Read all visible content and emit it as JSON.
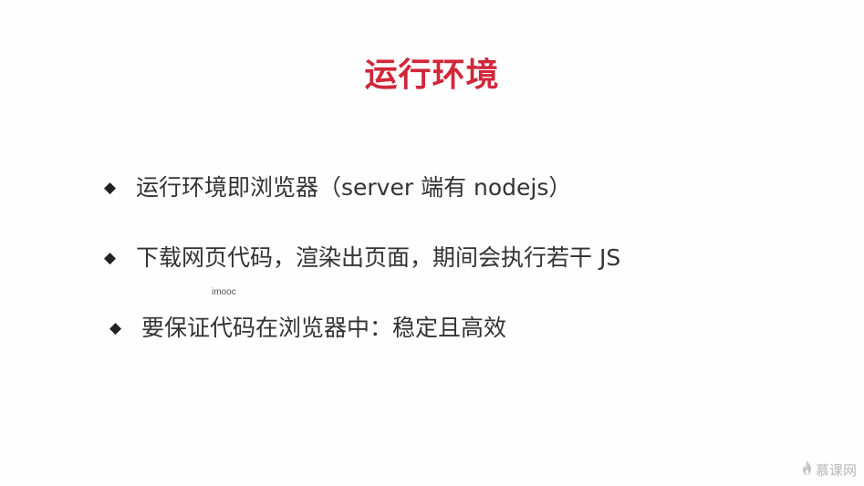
{
  "slide": {
    "title": "运行环境",
    "title_color": "#d0273a",
    "bullet_icon": "diamond-bullet",
    "bullets": [
      "运行环境即浏览器（server 端有 nodejs）",
      "下载网页代码，渲染出页面，期间会执行若干 JS",
      "要保证代码在浏览器中：稳定且高效"
    ]
  },
  "watermark": {
    "text": "imooc"
  },
  "logo": {
    "text": "慕课网",
    "icon": "flame-icon"
  }
}
